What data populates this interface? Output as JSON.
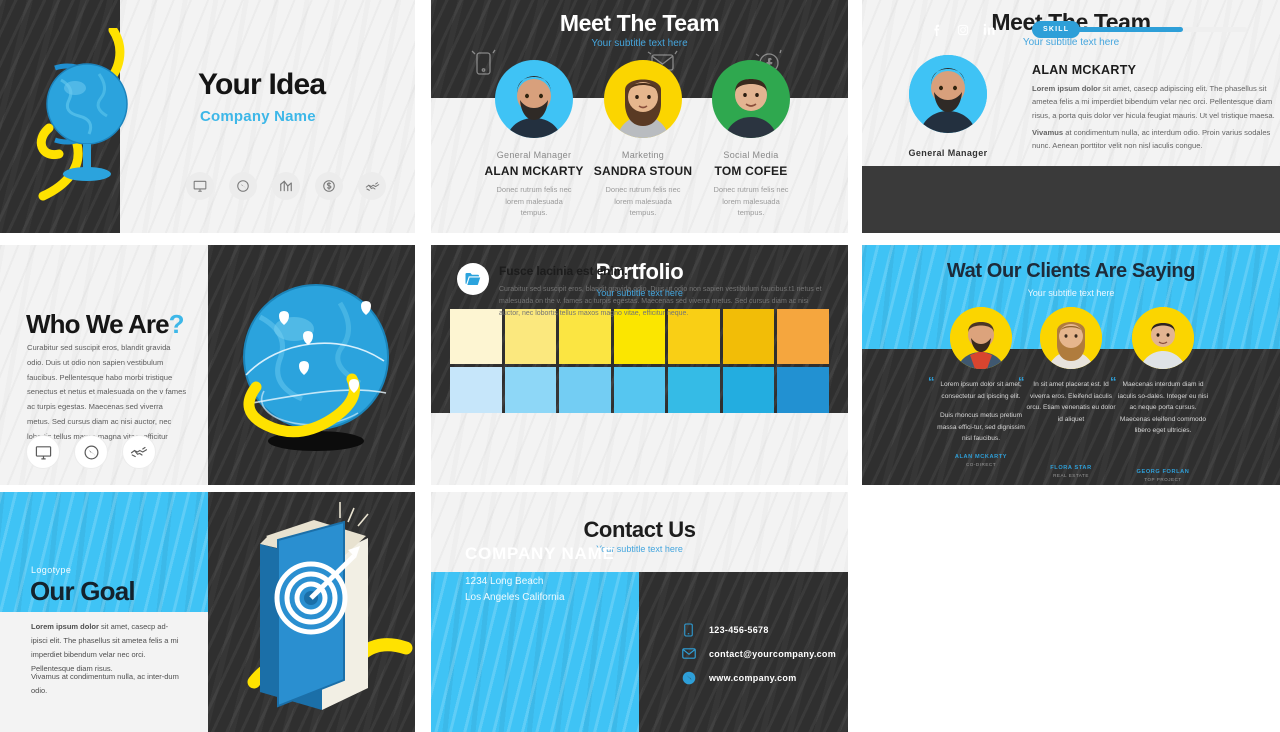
{
  "colors": {
    "accent_blue": "#3fc3f5",
    "link_blue": "#45a6de",
    "dark": "#3a3a3a",
    "yellow": "#fbd500",
    "green": "#2fa84f",
    "light": "#f3f3f3"
  },
  "slide1": {
    "title": "Your Idea",
    "company": "Company Name",
    "icons": [
      "monitor-icon",
      "globe-icon",
      "analytics-icon",
      "dollar-icon",
      "handshake-icon"
    ]
  },
  "slide2": {
    "title": "Meet The Team",
    "subtitle": "Your subtitle text here",
    "members": [
      {
        "role": "General Manager",
        "name": "ALAN MCKARTY",
        "desc": "Donec rutrum felis nec lorem malesuada tempus.",
        "color": "#3fc3f5"
      },
      {
        "role": "Marketing",
        "name": "SANDRA STOUN",
        "desc": "Donec rutrum felis nec lorem malesuada tempus.",
        "color": "#fbd500"
      },
      {
        "role": "Social Media",
        "name": "TOM COFEE",
        "desc": "Donec rutrum felis nec lorem malesuada tempus.",
        "color": "#2fa84f"
      }
    ]
  },
  "slide3": {
    "title": "Meet The Team",
    "subtitle": "Your subtitle text here",
    "name": "ALAN MCKARTY",
    "role": "General Manager",
    "paragraph1_bold": "Lorem ipsum dolor",
    "paragraph1": " sit amet, casecp adipiscing elit. The phasellus sit ametea felis a mi imperdiet bibendum velar nec orci. Pellentesque diam risus, a porta quis dolor ver hicula feugiat mauris. Ut vel tristique maesa.",
    "paragraph2_bold": "Vivamus",
    "paragraph2": " at condimentum nulla, ac interdum odio. Proin varius sodales nunc. Aenean porttitor velit non nisl iaculis congue.",
    "social": [
      "facebook-icon",
      "instagram-icon",
      "linkedin-icon"
    ],
    "skill_label": "SKILL",
    "skill_percent": 70
  },
  "slide4": {
    "title": "Who We Are",
    "title_mark": "?",
    "body": "Curabitur sed suscipit eros, blandit gravida odio. Duis ut odio non sapien vestibulum faucibus. Pellentesque habo morbi tristique senectus et netus et malesuada on the v fames ac turpis egestas. Maecenas sed viverra metus. Sed cursus diam ac nisi auctor, nec lobortis tellus maxos magna vitae, efficitur neque.",
    "icons": [
      "monitor-icon",
      "globe-icon",
      "handshake-icon"
    ]
  },
  "slide5": {
    "title": "Portfolio",
    "subtitle": "Your subtitle text here",
    "footer_heading": "Fusce lacinia est enim.",
    "footer_body": "Curabitur sed suscipit eros, blandit gravida odio. Duis ut odio non sapien vestibulum faucibus.t1 netus et malesuada on the v. fames ac turpis egestas. Maecenas sed viverra metus. Sed cursus diam ac nisi auctor, nec lobortis tellus maxos magno vitae, efficitur neque.",
    "grid_row_top": [
      "#fdf5d2",
      "#fbe87e",
      "#fbe542",
      "#fbe600",
      "#f9cf15",
      "#f2bd07",
      "#f5a63e"
    ],
    "grid_row_bottom": [
      "#c6e6fa",
      "#8ed7f7",
      "#73cdf3",
      "#56c6f0",
      "#35bbe6",
      "#23ade0",
      "#2291d2"
    ],
    "folder_icon": "folder-icon"
  },
  "slide6": {
    "title": "Wat Our Clients Are Saying",
    "subtitle": "Your subtitle text here",
    "testimonials": [
      {
        "quote1": "Lorem ipsum dolor sit amet, consectetur ad ipiscing elit.",
        "quote2": "Duis rhoncus metus pretium massa effici-tur, sed dignissim nisl faucibus.",
        "name": "ALAN MCKARTY",
        "role": "CO-DIRECT"
      },
      {
        "quote1": "In sit amet placerat est. Id viverra eros. Eleifend iaculis orcu. Etiam venenatis eu dolor id aliquet",
        "quote2": "",
        "name": "FLORA STAR",
        "role": "REAL ESTATE"
      },
      {
        "quote1": "Maecenas interdum diam id iaculis so-dales. Integer eu nisi ac neque porta cursus. Maecenas eleifend commodo libero eget ultricies.",
        "quote2": "",
        "name": "GEORG FORLAN",
        "role": "TOP PROJECT"
      }
    ]
  },
  "slide7": {
    "logotype": "Logotype",
    "title": "Our Goal",
    "body1_bold": "Lorem ipsum dolor",
    "body1": " sit amet, casecp ad-ipisci elit. The  phasellus sit ametea felis a mi    imperdiet bibendum velar nec orci.",
    "body1_line2": "Pellentesque diam risus.",
    "body2": "Vivamus at condimentum nulla, ac inter-dum odio."
  },
  "slide8": {
    "title": "Contact Us",
    "subtitle": "Your subtitle text here",
    "company_name": "COMPANY NAME",
    "address_line1": "1234 Long Beach",
    "address_line2": "Los Angeles California",
    "contacts": [
      {
        "icon": "phone-icon",
        "value": "123-456-5678"
      },
      {
        "icon": "mail-icon",
        "value": "contact@yourcompany.com"
      },
      {
        "icon": "globe-icon",
        "value": "www.company.com"
      }
    ]
  }
}
